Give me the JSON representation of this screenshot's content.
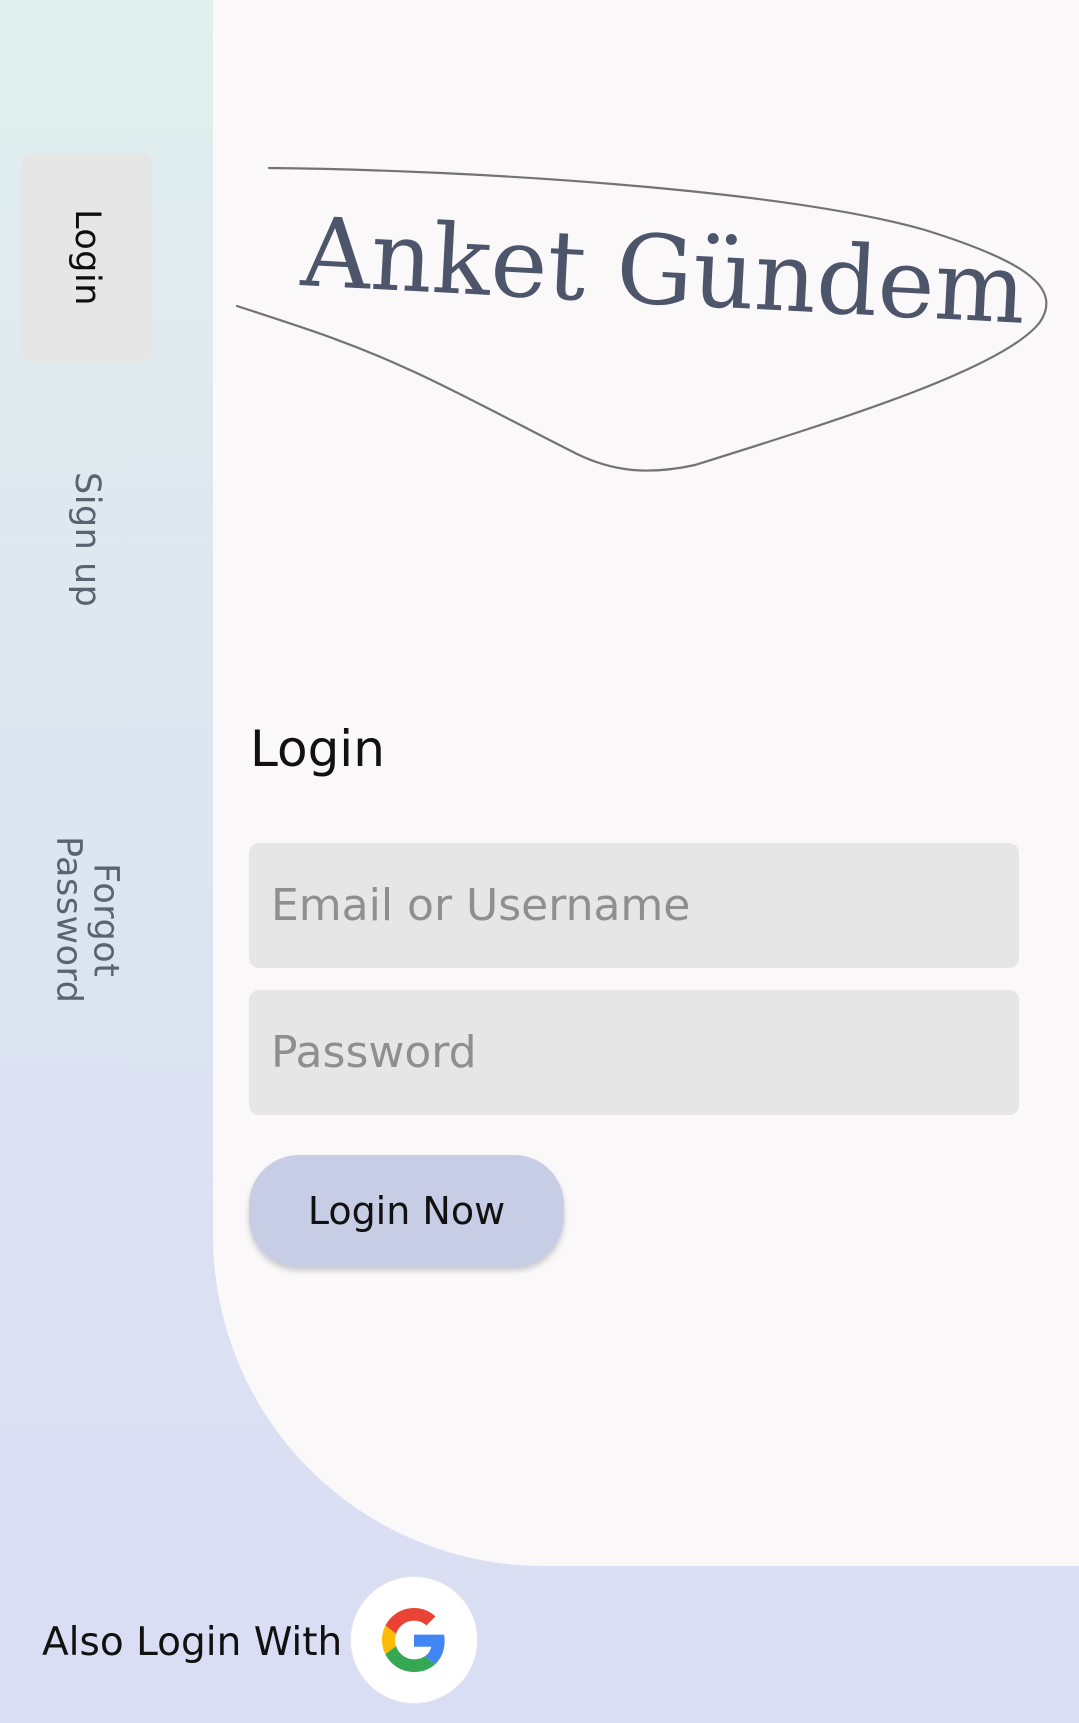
{
  "sidebar": {
    "tabs": [
      {
        "label": "Login",
        "active": true
      },
      {
        "label": "Sign up",
        "active": false
      },
      {
        "label": "Forgot Password",
        "active": false
      }
    ]
  },
  "logo": {
    "text": "Anket Gündem"
  },
  "login_form": {
    "title": "Login",
    "email_placeholder": "Email or Username",
    "password_placeholder": "Password",
    "submit_label": "Login Now"
  },
  "social": {
    "label": "Also Login With",
    "provider_icon": "google-icon"
  },
  "colors": {
    "panel_background": "#faf8f9",
    "field_background": "#e6e6e6",
    "button_background": "#c8cde6",
    "logo_text": "#4d556b"
  }
}
